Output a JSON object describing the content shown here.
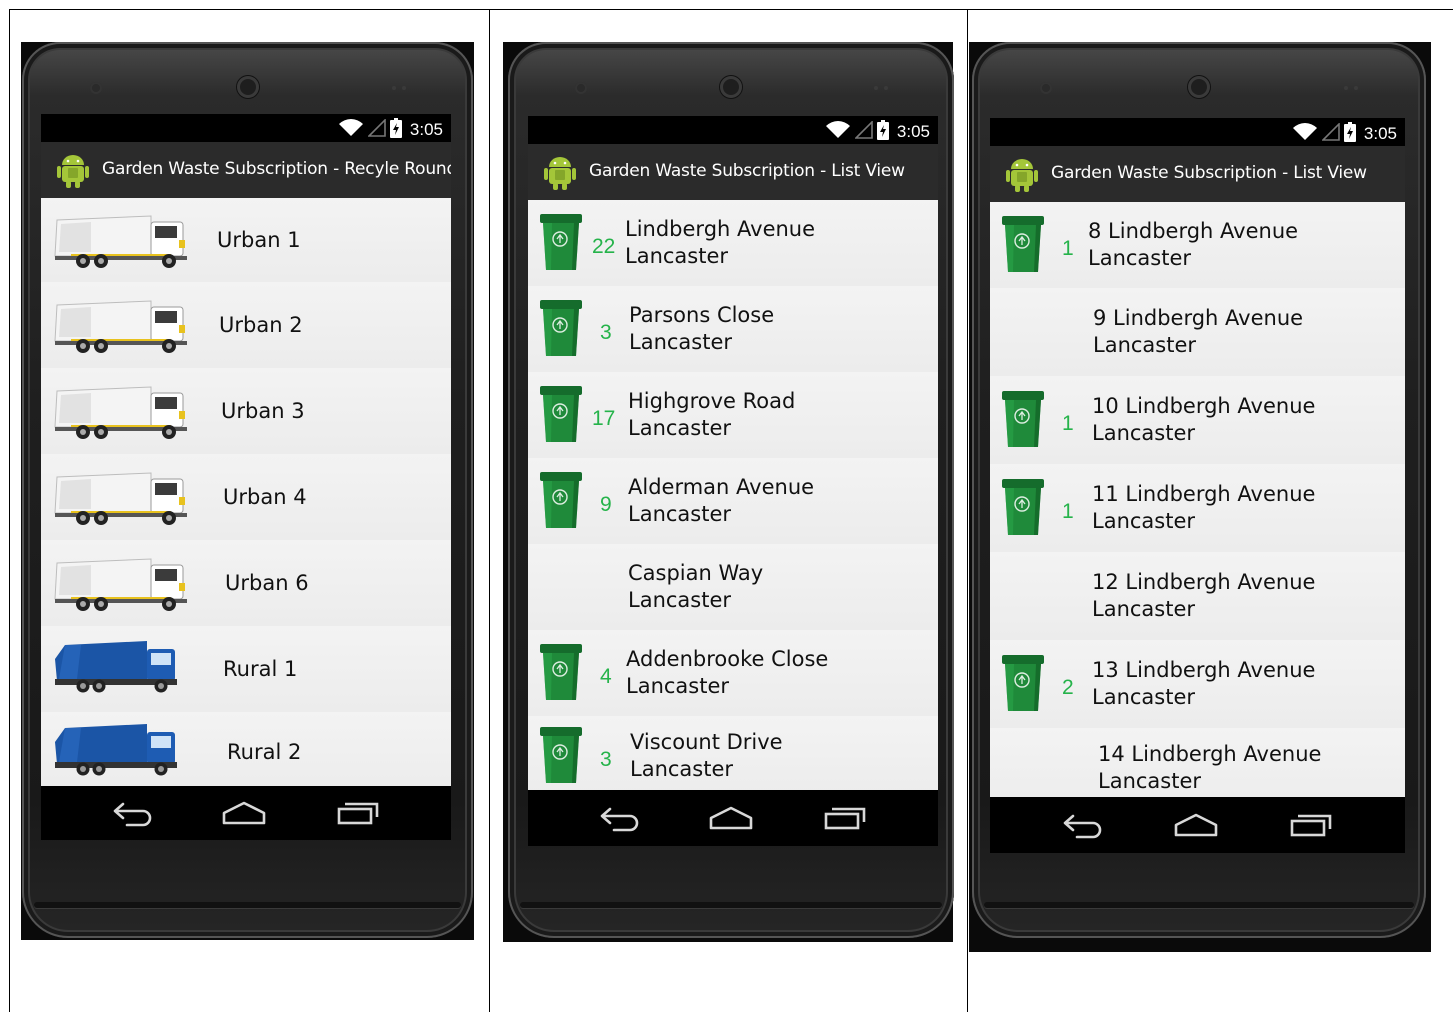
{
  "status_time": "3:05",
  "phones": [
    {
      "title": "Garden Waste Subscription - Recyle Round",
      "rows": [
        {
          "label": "Urban 1",
          "truck": "white"
        },
        {
          "label": "Urban 2",
          "truck": "white"
        },
        {
          "label": "Urban 3",
          "truck": "white"
        },
        {
          "label": "Urban 4",
          "truck": "white"
        },
        {
          "label": "Urban 6",
          "truck": "white"
        },
        {
          "label": "Rural 1",
          "truck": "blue"
        },
        {
          "label": "Rural 2",
          "truck": "blue"
        }
      ]
    },
    {
      "title": "Garden Waste Subscription - List View",
      "rows": [
        {
          "count": "22",
          "street": "Lindbergh Avenue",
          "town": "Lancaster",
          "bin": true
        },
        {
          "count": "3",
          "street": "Parsons Close",
          "town": "Lancaster",
          "bin": true
        },
        {
          "count": "17",
          "street": "Highgrove Road",
          "town": "Lancaster",
          "bin": true
        },
        {
          "count": "9",
          "street": "Alderman Avenue",
          "town": "Lancaster",
          "bin": true
        },
        {
          "count": "",
          "street": "Caspian Way",
          "town": "Lancaster",
          "bin": false
        },
        {
          "count": "4",
          "street": "Addenbrooke Close",
          "town": "Lancaster",
          "bin": true
        },
        {
          "count": "3",
          "street": "Viscount Drive",
          "town": "Lancaster",
          "bin": true
        }
      ]
    },
    {
      "title": "Garden Waste Subscription - List View",
      "rows": [
        {
          "count": "1",
          "street": "8 Lindbergh Avenue",
          "town": "Lancaster",
          "bin": true
        },
        {
          "count": "",
          "street": "9 Lindbergh Avenue",
          "town": "Lancaster",
          "bin": false
        },
        {
          "count": "1",
          "street": "10 Lindbergh Avenue",
          "town": "Lancaster",
          "bin": true
        },
        {
          "count": "1",
          "street": "11 Lindbergh Avenue",
          "town": "Lancaster",
          "bin": true
        },
        {
          "count": "",
          "street": "12 Lindbergh Avenue",
          "town": "Lancaster",
          "bin": false
        },
        {
          "count": "2",
          "street": "13 Lindbergh Avenue",
          "town": "Lancaster",
          "bin": true
        },
        {
          "count": "",
          "street": "14 Lindbergh Avenue",
          "town": "Lancaster",
          "bin": false
        }
      ]
    }
  ],
  "colors": {
    "bin_green": "#1f8a3a",
    "count_green": "#25b34a",
    "truck_white": "#f4f4f4",
    "truck_blue": "#1b55a6",
    "action_bar": "#2b2b2b"
  }
}
